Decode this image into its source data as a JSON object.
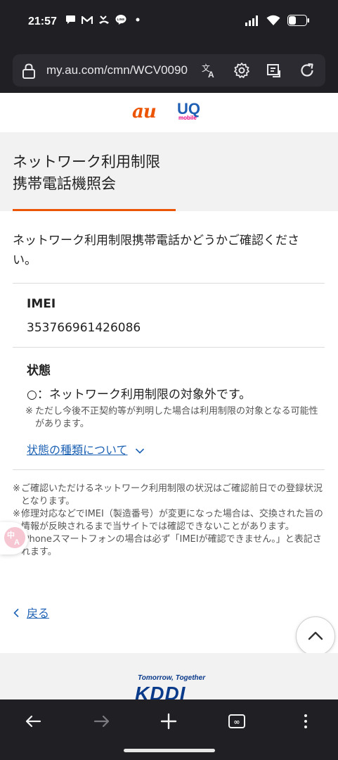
{
  "status_bar": {
    "time": "21:57",
    "notification_icons": [
      "chat-bubble-icon",
      "gmail-icon",
      "missed-call-icon",
      "line-app-icon",
      "dot-icon"
    ],
    "line_badge_text": "LINE",
    "system_icons": [
      "signal-icon",
      "wifi-icon",
      "battery-icon"
    ]
  },
  "browser": {
    "url": "my.au.com/cmn/WCV0090",
    "toolbar_icons": [
      "translate-icon",
      "settings-icon",
      "read-mode-icon",
      "reload-icon"
    ]
  },
  "header": {
    "au_logo_text": "au",
    "uq_logo_text": "UQ",
    "uq_logo_sub": "mobile",
    "accent_color": "#eb5505"
  },
  "page": {
    "title_line1": "ネットワーク利用制限",
    "title_line2": "携帯電話機照会",
    "intro": "ネットワーク利用制限携帯電話かどうかご確認ください。",
    "imei_label": "IMEI",
    "imei_value": "353766961426086",
    "status_label": "状態",
    "status_value": "○：ネットワーク利用制限の対象外です。",
    "status_note_mark": "※",
    "status_note": "ただし今後不正契約等が判明した場合は利用制限の対象となる可能性があります。",
    "status_types_link": "状態の種類について",
    "footnotes": [
      "ご確認いただけるネットワーク利用制限の状況はご確認前日での登録状況となります。",
      "修理対応などでIMEI（製造番号）が変更になった場合は、交換された旨の情報が反映されるまで当サイトでは確認できないことがあります。",
      "iPhoneスマートフォンの場合は必ず「IMEIが確認できません。」と表記されます。"
    ],
    "footnote_mark": "※",
    "back_link": "戻る",
    "link_color": "#1e62b4"
  },
  "footer": {
    "tagline": "Tomorrow, Together",
    "kddi_logo_text": "KDDI"
  },
  "nav_bar": {
    "buttons": [
      "back-arrow-icon",
      "forward-arrow-icon",
      "new-tab-icon",
      "tabs-icon",
      "more-menu-icon"
    ],
    "tab_count": "∞"
  }
}
